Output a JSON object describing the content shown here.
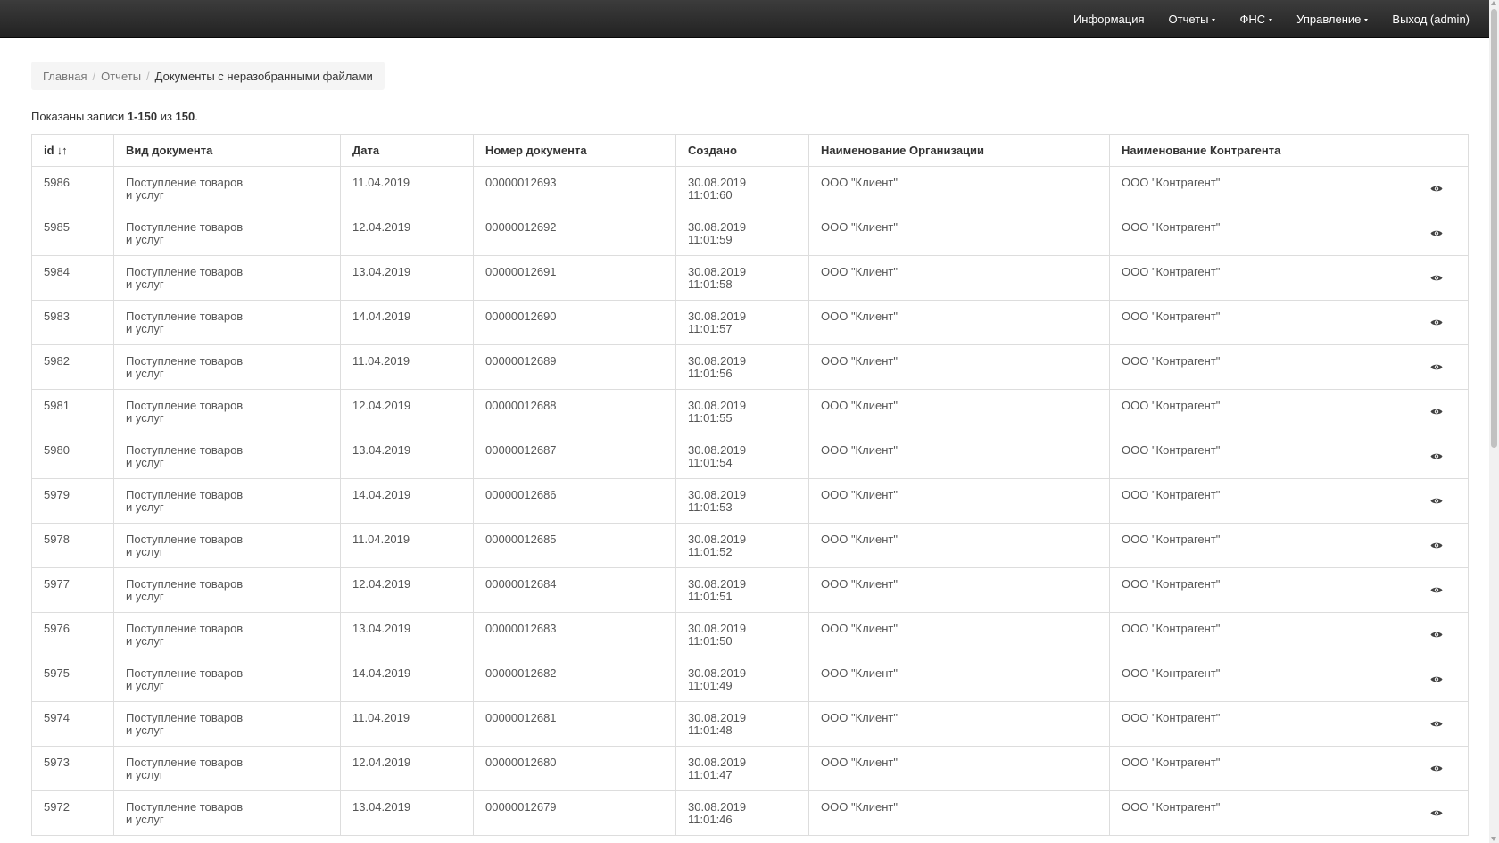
{
  "nav": {
    "items": [
      {
        "label": "Информация",
        "dropdown": false
      },
      {
        "label": "Отчеты",
        "dropdown": true
      },
      {
        "label": "ФНС",
        "dropdown": true
      },
      {
        "label": "Управление",
        "dropdown": true
      },
      {
        "label": "Выход (admin)",
        "dropdown": false
      }
    ]
  },
  "breadcrumb": {
    "home": "Главная",
    "reports": "Отчеты",
    "current": "Документы с неразобранными файлами",
    "separator": "/"
  },
  "summary": {
    "prefix": "Показаны записи ",
    "range": "1-150",
    "middle": " из ",
    "total": "150",
    "suffix": "."
  },
  "table": {
    "sort_icon": "↓↑",
    "view_icon": "eye-icon",
    "columns": [
      "id",
      "Вид документа",
      "Дата",
      "Номер документа",
      "Создано",
      "Наименование Организации",
      "Наименование Контрагента",
      ""
    ],
    "rows": [
      {
        "id": "5986",
        "type_line1": "Поступление товаров",
        "type_line2": "и услуг",
        "date": "11.04.2019",
        "number": "00000012693",
        "created_date": "30.08.2019",
        "created_time": "11:01:60",
        "org": "ООО \"Клиент\"",
        "counterparty": "ООО \"Контрагент\""
      },
      {
        "id": "5985",
        "type_line1": "Поступление товаров",
        "type_line2": "и услуг",
        "date": "12.04.2019",
        "number": "00000012692",
        "created_date": "30.08.2019",
        "created_time": "11:01:59",
        "org": "ООО \"Клиент\"",
        "counterparty": "ООО \"Контрагент\""
      },
      {
        "id": "5984",
        "type_line1": "Поступление товаров",
        "type_line2": "и услуг",
        "date": "13.04.2019",
        "number": "00000012691",
        "created_date": "30.08.2019",
        "created_time": "11:01:58",
        "org": "ООО \"Клиент\"",
        "counterparty": "ООО \"Контрагент\""
      },
      {
        "id": "5983",
        "type_line1": "Поступление товаров",
        "type_line2": "и услуг",
        "date": "14.04.2019",
        "number": "00000012690",
        "created_date": "30.08.2019",
        "created_time": "11:01:57",
        "org": "ООО \"Клиент\"",
        "counterparty": "ООО \"Контрагент\""
      },
      {
        "id": "5982",
        "type_line1": "Поступление товаров",
        "type_line2": "и услуг",
        "date": "11.04.2019",
        "number": "00000012689",
        "created_date": "30.08.2019",
        "created_time": "11:01:56",
        "org": "ООО \"Клиент\"",
        "counterparty": "ООО \"Контрагент\""
      },
      {
        "id": "5981",
        "type_line1": "Поступление товаров",
        "type_line2": "и услуг",
        "date": "12.04.2019",
        "number": "00000012688",
        "created_date": "30.08.2019",
        "created_time": "11:01:55",
        "org": "ООО \"Клиент\"",
        "counterparty": "ООО \"Контрагент\""
      },
      {
        "id": "5980",
        "type_line1": "Поступление товаров",
        "type_line2": "и услуг",
        "date": "13.04.2019",
        "number": "00000012687",
        "created_date": "30.08.2019",
        "created_time": "11:01:54",
        "org": "ООО \"Клиент\"",
        "counterparty": "ООО \"Контрагент\""
      },
      {
        "id": "5979",
        "type_line1": "Поступление товаров",
        "type_line2": "и услуг",
        "date": "14.04.2019",
        "number": "00000012686",
        "created_date": "30.08.2019",
        "created_time": "11:01:53",
        "org": "ООО \"Клиент\"",
        "counterparty": "ООО \"Контрагент\""
      },
      {
        "id": "5978",
        "type_line1": "Поступление товаров",
        "type_line2": "и услуг",
        "date": "11.04.2019",
        "number": "00000012685",
        "created_date": "30.08.2019",
        "created_time": "11:01:52",
        "org": "ООО \"Клиент\"",
        "counterparty": "ООО \"Контрагент\""
      },
      {
        "id": "5977",
        "type_line1": "Поступление товаров",
        "type_line2": "и услуг",
        "date": "12.04.2019",
        "number": "00000012684",
        "created_date": "30.08.2019",
        "created_time": "11:01:51",
        "org": "ООО \"Клиент\"",
        "counterparty": "ООО \"Контрагент\""
      },
      {
        "id": "5976",
        "type_line1": "Поступление товаров",
        "type_line2": "и услуг",
        "date": "13.04.2019",
        "number": "00000012683",
        "created_date": "30.08.2019",
        "created_time": "11:01:50",
        "org": "ООО \"Клиент\"",
        "counterparty": "ООО \"Контрагент\""
      },
      {
        "id": "5975",
        "type_line1": "Поступление товаров",
        "type_line2": "и услуг",
        "date": "14.04.2019",
        "number": "00000012682",
        "created_date": "30.08.2019",
        "created_time": "11:01:49",
        "org": "ООО \"Клиент\"",
        "counterparty": "ООО \"Контрагент\""
      },
      {
        "id": "5974",
        "type_line1": "Поступление товаров",
        "type_line2": "и услуг",
        "date": "11.04.2019",
        "number": "00000012681",
        "created_date": "30.08.2019",
        "created_time": "11:01:48",
        "org": "ООО \"Клиент\"",
        "counterparty": "ООО \"Контрагент\""
      },
      {
        "id": "5973",
        "type_line1": "Поступление товаров",
        "type_line2": "и услуг",
        "date": "12.04.2019",
        "number": "00000012680",
        "created_date": "30.08.2019",
        "created_time": "11:01:47",
        "org": "ООО \"Клиент\"",
        "counterparty": "ООО \"Контрагент\""
      },
      {
        "id": "5972",
        "type_line1": "Поступление товаров",
        "type_line2": "и услуг",
        "date": "13.04.2019",
        "number": "00000012679",
        "created_date": "30.08.2019",
        "created_time": "11:01:46",
        "org": "ООО \"Клиент\"",
        "counterparty": "ООО \"Контрагент\""
      }
    ]
  }
}
